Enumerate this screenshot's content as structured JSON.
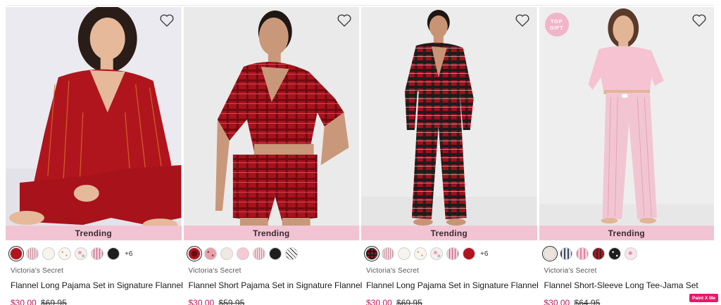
{
  "products": [
    {
      "trending_label": "Trending",
      "brand": "Victoria's Secret",
      "name": "Flannel Long Pajama Set in Signature Flannel",
      "sale_price": "$30.00",
      "original_price": "$69.95",
      "more_colors": "+6",
      "swatches": [
        "red-shimmer",
        "pink-stripe",
        "white",
        "gold-dot",
        "floral",
        "pink-plaid",
        "black"
      ],
      "selected_swatch": 0
    },
    {
      "trending_label": "Trending",
      "brand": "Victoria's Secret",
      "name": "Flannel Short Pajama Set in Signature Flannel",
      "sale_price": "$30.00",
      "original_price": "$59.95",
      "swatches": [
        "red-plaid",
        "pink-dot",
        "cream",
        "pink",
        "candy-stripe",
        "black",
        "bw-diagonal"
      ],
      "selected_swatch": 0
    },
    {
      "trending_label": "Trending",
      "brand": "Victoria's Secret",
      "name": "Flannel Long Pajama Set in Signature Flannel",
      "sale_price": "$30.00",
      "original_price": "$69.95",
      "more_colors": "+6",
      "swatches": [
        "red-tartan",
        "pink-stripe",
        "white",
        "gold-dot",
        "floral",
        "pink-plaid",
        "red"
      ],
      "selected_swatch": 0
    },
    {
      "badge": "TOP GIFT",
      "trending_label": "Trending",
      "brand": "Victoria's Secret",
      "name": "Flannel Short-Sleeve Long Tee-Jama Set",
      "sale_price": "$30.00",
      "original_price": "$64.95",
      "swatches": [
        "shell",
        "grey-plaid",
        "pink-plaid",
        "dark-plaid",
        "black-dots",
        "pink-floral"
      ],
      "selected_swatch": 0
    }
  ],
  "badge_top_gift": [
    "TOP",
    "GIFT"
  ],
  "paint_badge": "Paint X Me",
  "colors": {
    "accent_sale": "#c2185b",
    "trending_bar": "#f2c4d3"
  }
}
